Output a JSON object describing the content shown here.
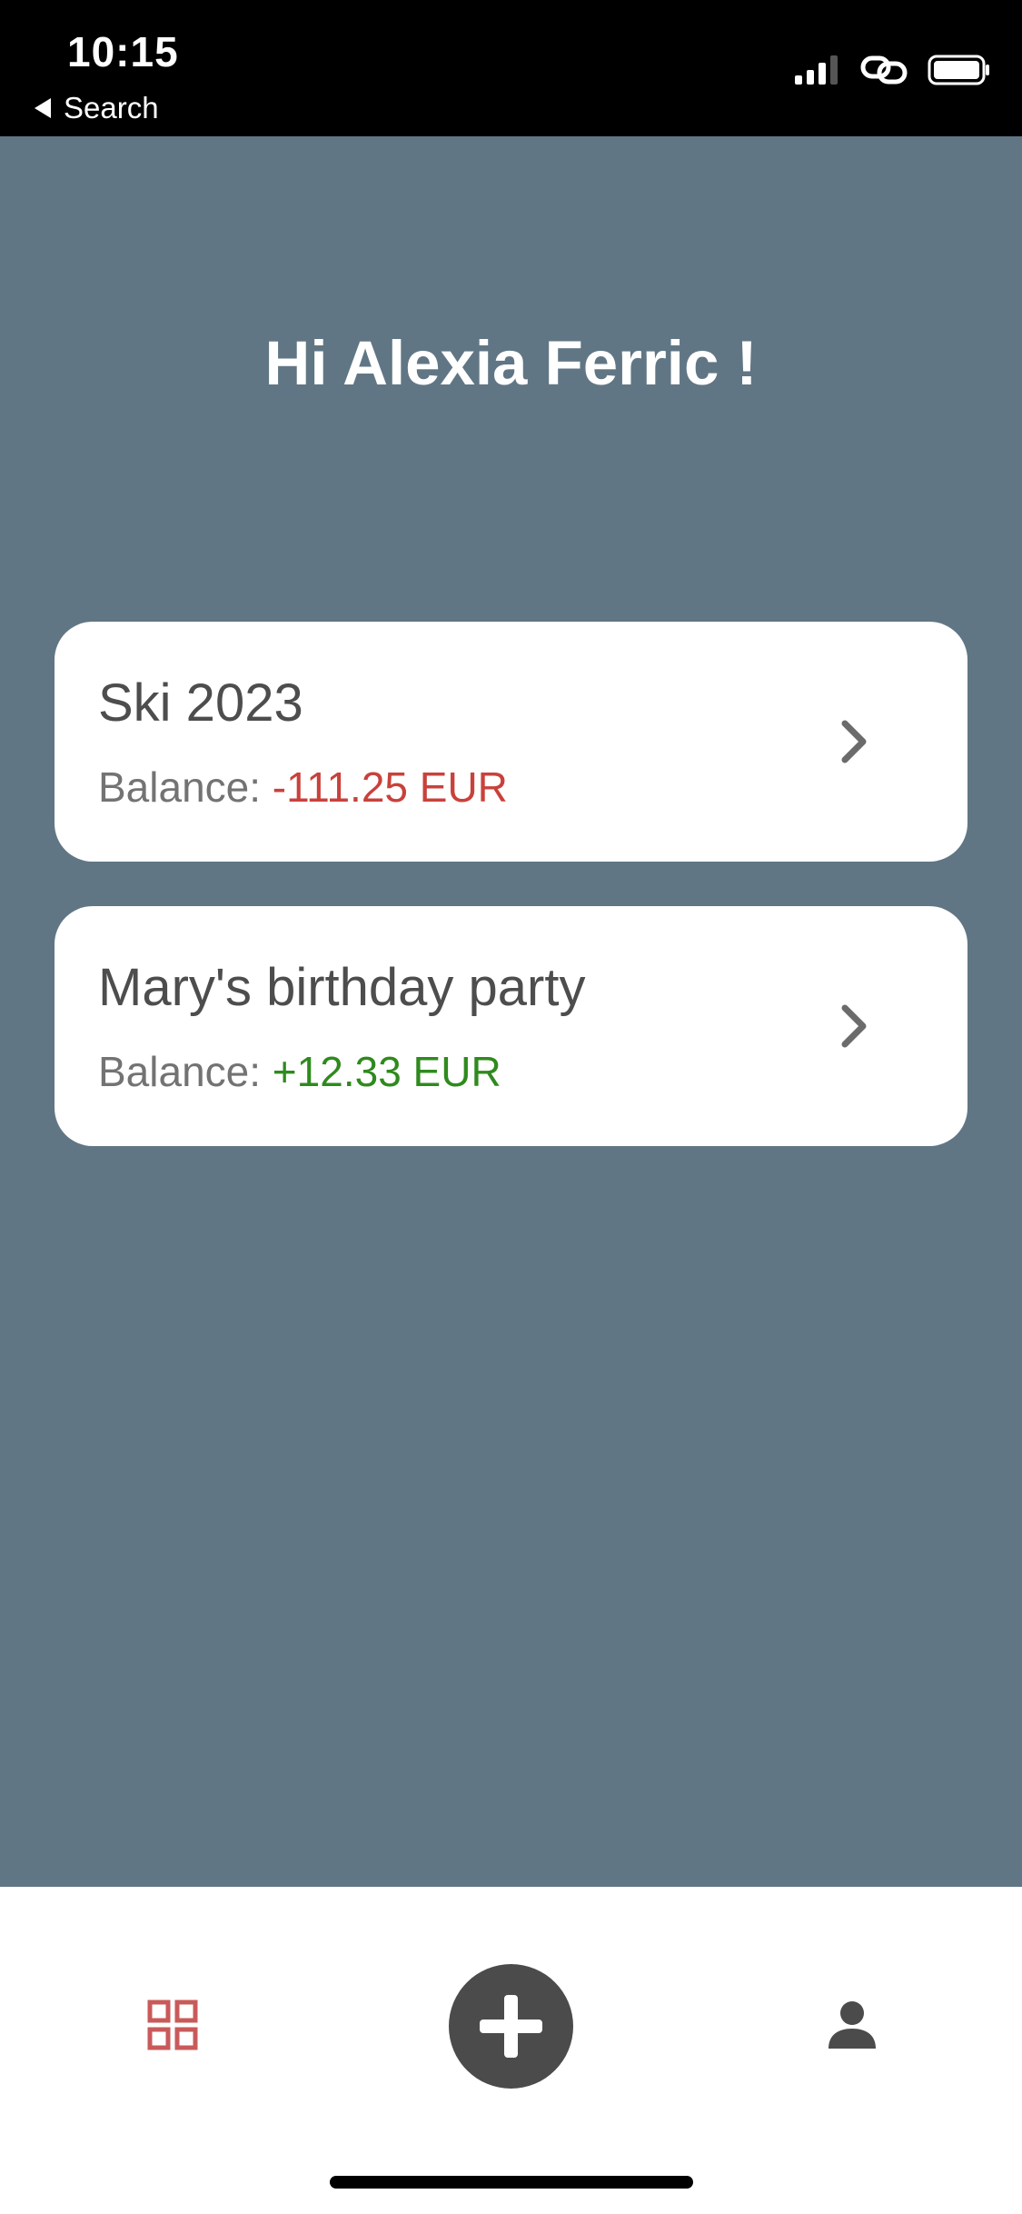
{
  "status_bar": {
    "time": "10:15",
    "back_label": "Search",
    "icons": [
      "signal-icon",
      "link-icon",
      "battery-icon"
    ]
  },
  "greeting": "Hi Alexia Ferric !",
  "groups": [
    {
      "name": "Ski 2023",
      "balance_label": "Balance:",
      "balance_value": "-111.25 EUR",
      "balance_color": "#c9413b"
    },
    {
      "name": "Mary's birthday party",
      "balance_label": "Balance:",
      "balance_value": "+12.33 EUR",
      "balance_color": "#2f8a1e"
    }
  ],
  "colors": {
    "background": "#617684",
    "accent": "#c95a5a",
    "negative": "#c9413b",
    "positive": "#2f8a1e"
  },
  "tab_bar": {
    "items": [
      "grid-icon",
      "add-icon",
      "person-icon"
    ],
    "active": "grid-icon"
  }
}
